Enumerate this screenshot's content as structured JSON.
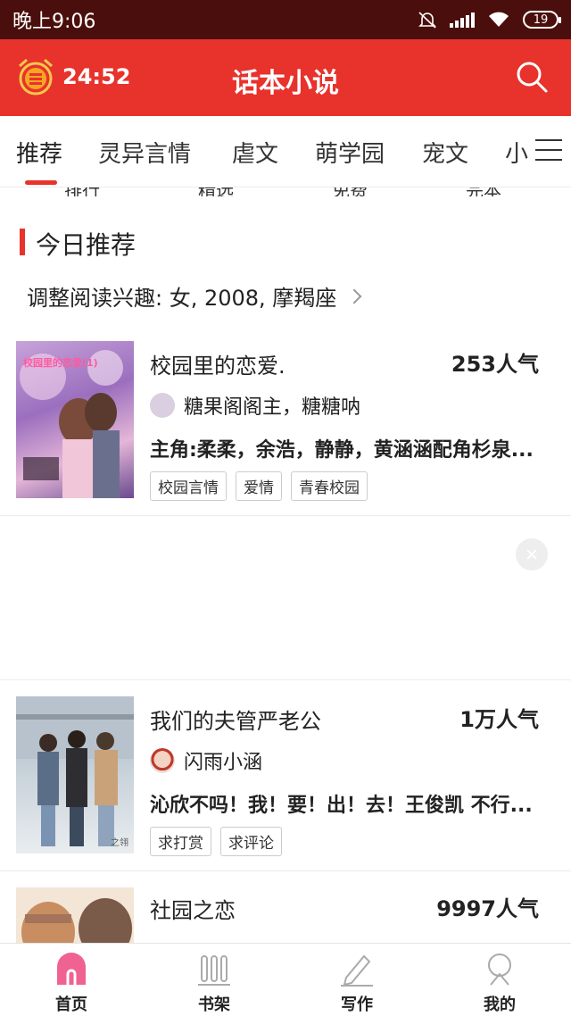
{
  "status": {
    "time": "晚上9:06",
    "battery": "19"
  },
  "appbar": {
    "timer": "24:52",
    "title": "话本小说"
  },
  "tabs": [
    "推荐",
    "灵异言情",
    "虐文",
    "萌学园",
    "宠文",
    "小"
  ],
  "clipped_row": [
    "排行",
    "精选",
    "免费",
    "完本"
  ],
  "section": {
    "title": "今日推荐",
    "interest": "调整阅读兴趣: 女, 2008, 摩羯座"
  },
  "books": [
    {
      "title": "校园里的恋爱.",
      "popularity": "253人气",
      "author": "糖果阁阁主，糖糖呐",
      "description": "主角:柔柔，余浩，静静，黄涵涵配角杉泉...",
      "tags": [
        "校园言情",
        "爱情",
        "青春校园"
      ],
      "cover_text": "校园里的恋爱(1)"
    },
    {
      "title": "我们的夫管严老公",
      "popularity": "1万人气",
      "author": "闪雨小涵",
      "description": "沁欣不吗！我！要！出！去！王俊凯 不行...",
      "tags": [
        "求打赏",
        "求评论"
      ],
      "cover_text": "之翎"
    },
    {
      "title": "社园之恋",
      "popularity": "9997人气"
    }
  ],
  "bottom_nav": [
    {
      "label": "首页",
      "icon": "home-icon",
      "active": true
    },
    {
      "label": "书架",
      "icon": "bookshelf-icon"
    },
    {
      "label": "写作",
      "icon": "pen-icon"
    },
    {
      "label": "我的",
      "icon": "user-icon"
    }
  ],
  "colors": {
    "brand": "#e8322c",
    "statusbar": "#4a0f0c",
    "active_nav": "#f06292"
  }
}
